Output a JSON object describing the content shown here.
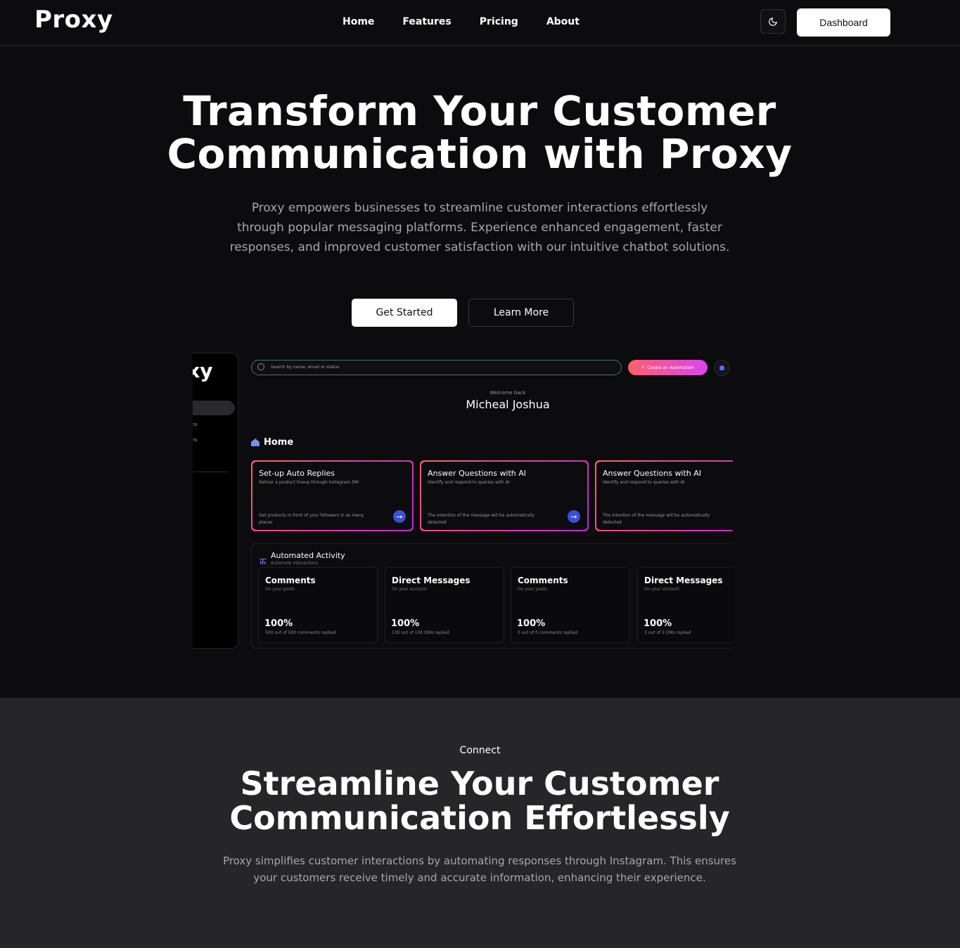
{
  "nav": {
    "logo": "Proxy",
    "links": [
      "Home",
      "Features",
      "Pricing",
      "About"
    ],
    "theme_icon": "moon-icon",
    "dashboard_label": "Dashboard"
  },
  "hero": {
    "title_line1": "Transform Your Customer",
    "title_line2": "Communication with Proxy",
    "subtitle": "Proxy empowers businesses to streamline customer interactions effortlessly through popular messaging platforms. Experience enhanced engagement, faster responses, and improved customer satisfaction with our intuitive chatbot solutions.",
    "primary_cta": "Get Started",
    "secondary_cta": "Learn More"
  },
  "preview": {
    "logo": "oxy",
    "sidebar_items": [
      "ations",
      "ations",
      "s"
    ],
    "search_placeholder": "Search by name, email or status",
    "create_label": "Create an Automation",
    "welcome": "Welcome back",
    "user_name": "Micheal Joshua",
    "home_label": "Home",
    "cards": [
      {
        "title": "Set-up Auto Replies",
        "desc": "Deliver a product lineup through Instagram DM",
        "foot": "Get products in front of your followers in as many places"
      },
      {
        "title": "Answer Questions with AI",
        "desc": "Identify and respond to queries with AI",
        "foot": "The intention of the message will be automatically detected"
      },
      {
        "title": "Answer Questions with AI",
        "desc": "Identify and respond to queries with AI",
        "foot": "The intention of the message will be automatically detected"
      }
    ],
    "activity": {
      "title": "Automated Activity",
      "subtitle": "Automate interactions",
      "stats": [
        {
          "title": "Comments",
          "sub": "On your posts",
          "pct": "100%",
          "foot": "500 out of 500 comments replied"
        },
        {
          "title": "Direct Messages",
          "sub": "On your account",
          "pct": "100%",
          "foot": "130 out of 130 DMs replied"
        },
        {
          "title": "Comments",
          "sub": "On your posts",
          "pct": "100%",
          "foot": "0 out of 0 comments replied"
        },
        {
          "title": "Direct Messages",
          "sub": "On your account",
          "pct": "100%",
          "foot": "3 out of 3 DMs replied"
        }
      ]
    }
  },
  "section2": {
    "kicker": "Connect",
    "title_line1": "Streamline Your Customer",
    "title_line2": "Communication Effortlessly",
    "subtitle": "Proxy simplifies customer interactions by automating responses through Instagram. This ensures your customers receive timely and accurate information, enhancing their experience."
  }
}
